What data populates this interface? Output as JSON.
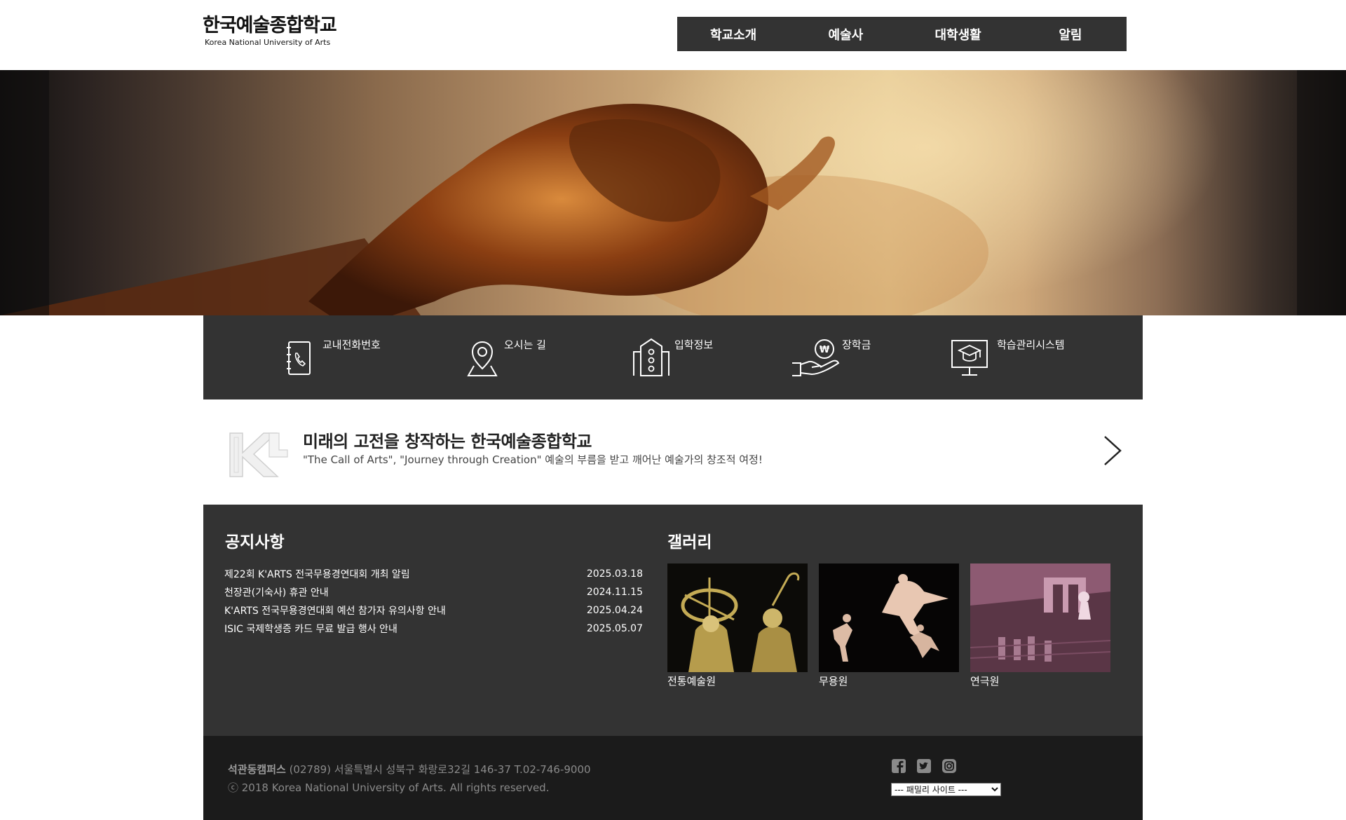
{
  "header": {
    "logo_kr": "한국예술종합학교",
    "logo_en": "Korea National University of Arts",
    "nav": [
      "학교소개",
      "예술사",
      "대학생활",
      "알림"
    ]
  },
  "quick_menu": [
    {
      "label": "교내전화번호",
      "icon": "phone-book-icon"
    },
    {
      "label": "오시는 길",
      "icon": "map-pin-icon"
    },
    {
      "label": "입학정보",
      "icon": "building-icon"
    },
    {
      "label": "장학금",
      "icon": "scholarship-hand-icon"
    },
    {
      "label": "학습관리시스템",
      "icon": "lms-monitor-icon"
    }
  ],
  "slogan": {
    "title": "미래의 고전을 창작하는 한국예술종합학교",
    "desc": "\"The Call of Arts\", \"Journey through Creation\" 예술의 부름을 받고 깨어난 예술가의 창조적 여정!"
  },
  "notice": {
    "title": "공지사항",
    "items": [
      {
        "text": "제22회 K'ARTS 전국무용경연대회 개최 알림",
        "date": "2025.03.18"
      },
      {
        "text": "천장관(기숙사) 휴관 안내",
        "date": "2024.11.15"
      },
      {
        "text": "K'ARTS 전국무용경연대회 예선 참가자 유의사항 안내",
        "date": "2025.04.24"
      },
      {
        "text": "ISIC 국제학생증 카드 무료 발급 행사 안내",
        "date": "2025.05.07"
      }
    ]
  },
  "gallery": {
    "title": "갤러리",
    "items": [
      {
        "caption": "전통예술원",
        "tint": "#c4ab55"
      },
      {
        "caption": "무용원",
        "tint": "#e8c7b2"
      },
      {
        "caption": "연극원",
        "tint": "#b77b95"
      }
    ]
  },
  "footer": {
    "campus": "석관동캠퍼스",
    "address": " (02789) 서울특별시 성북구 화랑로32길 146-37 T.02-746-9000",
    "copyright": "ⓒ 2018 Korea National University of Arts. All rights reserved.",
    "sns": [
      "facebook-icon",
      "twitter-icon",
      "instagram-icon"
    ],
    "family_site": "--- 패밀리 사이트 ---"
  },
  "colors": {
    "nav_bg": "#333333",
    "panel_bg": "#333333",
    "footer_bg": "#1b1b1b"
  }
}
